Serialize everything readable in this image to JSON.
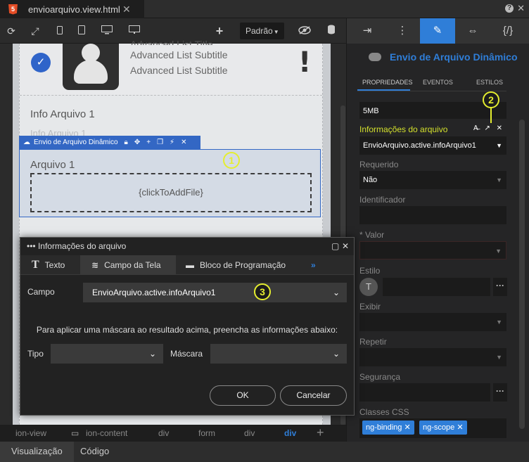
{
  "file_tab": {
    "icon": "5",
    "name": "envioarquivo.view.html",
    "close": "✕"
  },
  "window": {
    "help": "?",
    "close": "✕"
  },
  "toolbar": {
    "icons": [
      "refresh-icon",
      "expand-icon",
      "phone-icon",
      "tablet-icon",
      "desktop-icon",
      "monitor-icon",
      "plus-icon",
      "eye-slash-icon",
      "database-icon"
    ],
    "theme_select": "Padrão"
  },
  "canvas": {
    "list_title": "Advanced List Title",
    "list_subtitles": [
      "Advanced List Subtitle",
      "Advanced List Subtitle"
    ],
    "info_label": "Info Arquivo 1",
    "info_ghost": "Info Arquivo 1",
    "component_bar": "Envio de Arquivo Dinâmico",
    "arquivo_label": "Arquivo 1",
    "drop_text": "{clickToAddFile}"
  },
  "badges": {
    "one": "1",
    "two": "2",
    "three": "3"
  },
  "breadcrumb": [
    {
      "label": "ion-view",
      "active": false
    },
    {
      "label": "ion-content",
      "active": false
    },
    {
      "label": "div",
      "active": false
    },
    {
      "label": "form",
      "active": false
    },
    {
      "label": "div",
      "active": false
    },
    {
      "label": "div",
      "active": true
    }
  ],
  "bottom_tabs": [
    "Visualização",
    "Código"
  ],
  "right_panel": {
    "title": "Envio de Arquivo Dinâmico",
    "tabs": [
      "PROPRIEDADES",
      "EVENTOS",
      "ESTILOS"
    ],
    "size_value": "5MB",
    "info_label": "Informações do arquivo",
    "info_value": "EnvioArquivo.active.infoArquivo1",
    "requerido_label": "Requerido",
    "requerido_value": "Não",
    "identificador_label": "Identificador",
    "valor_label": "* Valor",
    "estilo_label": "Estilo",
    "estilo_letter": "T",
    "exibir_label": "Exibir",
    "repetir_label": "Repetir",
    "seguranca_label": "Segurança",
    "classes_label": "Classes CSS",
    "classes": [
      "ng-binding",
      "ng-scope"
    ]
  },
  "dialog": {
    "title": "Informações do arquivo",
    "tabs": [
      {
        "icon": "T",
        "label": "Texto"
      },
      {
        "icon": "≋",
        "label": "Campo da Tela"
      },
      {
        "icon": "▬",
        "label": "Bloco de Programação"
      }
    ],
    "more": "»",
    "campo_label": "Campo",
    "campo_value": "EnvioArquivo.active.infoArquivo1",
    "note": "Para aplicar uma máscara ao resultado acima, preencha as informações abaixo:",
    "tipo_label": "Tipo",
    "mascara_label": "Máscara",
    "ok": "OK",
    "cancel": "Cancelar"
  },
  "colors": {
    "accent": "#2f7ed8",
    "highlight": "#e5ee2f",
    "selection": "#3367c4"
  }
}
